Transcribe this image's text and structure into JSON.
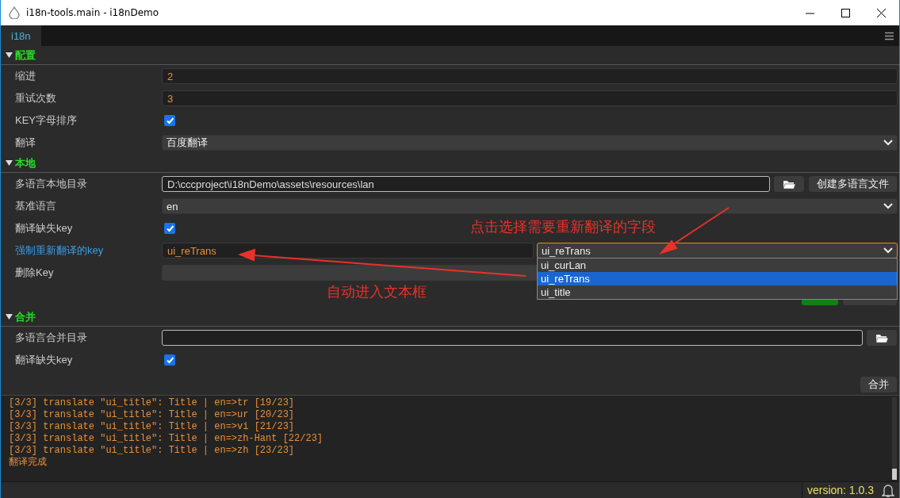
{
  "window": {
    "title": "i18n-tools.main - i18nDemo"
  },
  "tabs": [
    {
      "label": "i18n",
      "selected": true
    }
  ],
  "sections": [
    {
      "title": "配置",
      "expanded": true,
      "rows": [
        {
          "kind": "text",
          "label": "缩进",
          "value": "2",
          "focused": false
        },
        {
          "kind": "text",
          "label": "重试次数",
          "value": "3",
          "focused": false
        },
        {
          "kind": "checkbox",
          "label": "KEY字母排序",
          "checked": true,
          "focused": false
        },
        {
          "kind": "select",
          "label": "翻译",
          "value": "百度翻译",
          "focused": false
        }
      ]
    },
    {
      "title": "本地",
      "expanded": true,
      "rows": [
        {
          "kind": "path",
          "label": "多语言本地目录",
          "value": "D:\\cccproject\\i18nDemo\\assets\\resources\\lan",
          "action": "创建多语言文件",
          "focused": false
        },
        {
          "kind": "select",
          "label": "基准语言",
          "value": "en",
          "focused": false
        },
        {
          "kind": "checkbox",
          "label": "翻译缺失key",
          "checked": true,
          "focused": false
        },
        {
          "kind": "keyselect",
          "label": "强制重新翻译的key",
          "value": "ui_reTrans",
          "choice": "ui_reTrans",
          "focused": true,
          "options": [
            {
              "label": "ui_curLan",
              "selected": false
            },
            {
              "label": "ui_reTrans",
              "selected": true
            },
            {
              "label": "ui_title",
              "selected": false
            }
          ]
        },
        {
          "kind": "input",
          "label": "删除Key",
          "value": "",
          "focused": false
        }
      ],
      "buttons": [
        {
          "primary": true
        },
        {
          "primary": false
        }
      ]
    },
    {
      "title": "合并",
      "expanded": true,
      "rows": [
        {
          "kind": "path",
          "label": "多语言合并目录",
          "value": "",
          "focused": false
        },
        {
          "kind": "checkbox",
          "label": "翻译缺失key",
          "checked": true,
          "focused": false
        }
      ],
      "buttons": [
        {
          "label": "合并",
          "primary": false
        }
      ]
    }
  ],
  "log": [
    "[3/3] translate \"ui_title\": Title | en=>tr [19/23]",
    "[3/3] translate \"ui_title\": Title | en=>ur [20/23]",
    "[3/3] translate \"ui_title\": Title | en=>vi [21/23]",
    "[3/3] translate \"ui_title\": Title | en=>zh-Hant [22/23]",
    "[3/3] translate \"ui_title\": Title | en=>zh [23/23]",
    "翻译完成"
  ],
  "status_bar": {
    "version": "version: 1.0.3"
  },
  "annotations": [
    {
      "text": "点击选择需要重新翻译的字段"
    },
    {
      "text": "自动进入文本框"
    }
  ]
}
